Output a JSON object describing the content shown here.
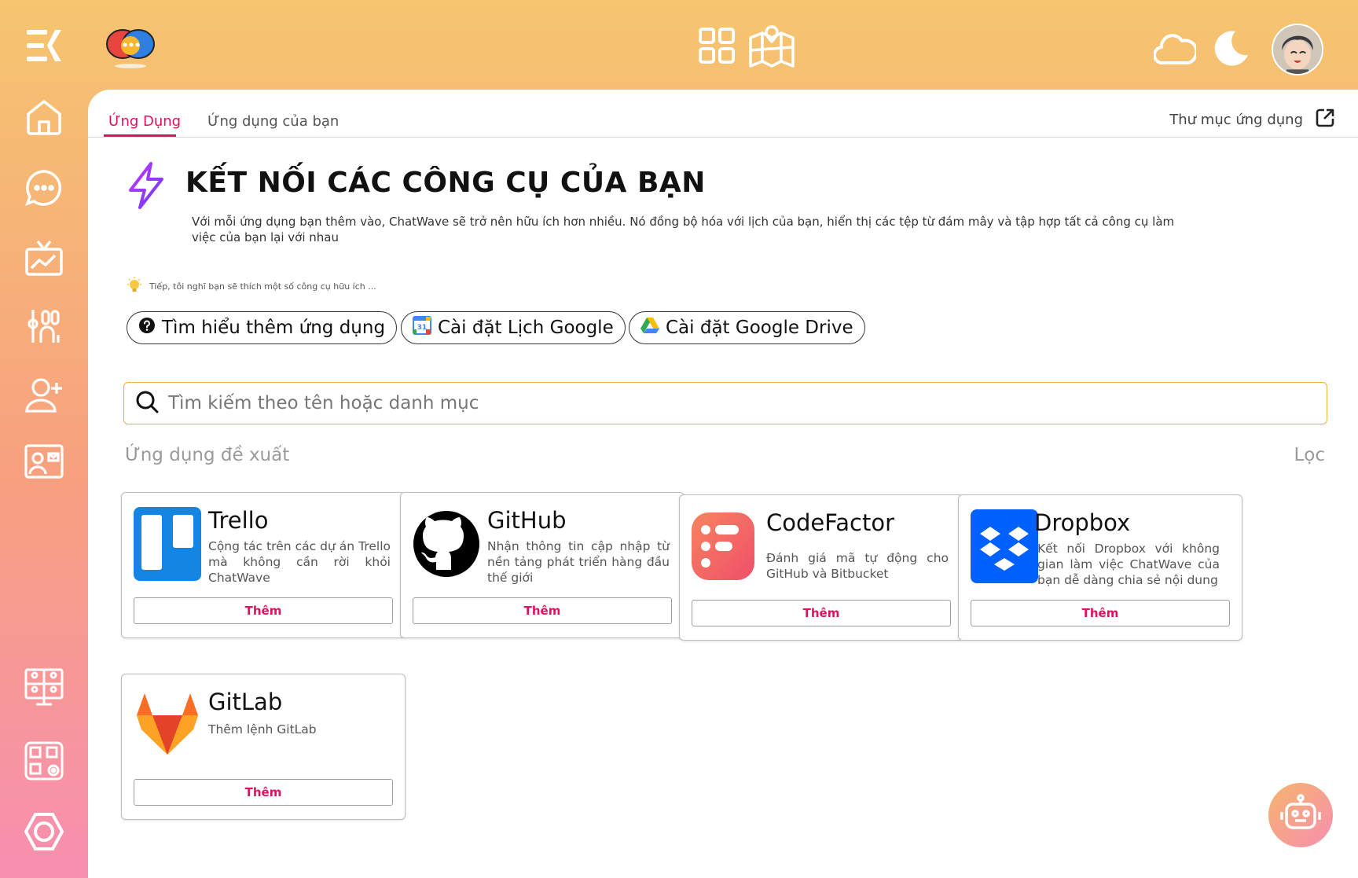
{
  "tabs": [
    {
      "label": "Ứng Dụng",
      "active": true
    },
    {
      "label": "Ứng dụng của bạn",
      "active": false
    }
  ],
  "directory_link": "Thư mục ứng dụng",
  "hero": {
    "title": "KẾT NỐI CÁC CÔNG CỤ CỦA BẠN",
    "description": "Với mỗi ứng dụng bạn thêm vào, ChatWave sẽ trở nên hữu ích hơn nhiều. Nó đồng bộ hóa với lịch của bạn, hiển thị các tệp từ đám mây và tập hợp tất cả công cụ làm việc của bạn lại với nhau"
  },
  "tip": "Tiếp, tôi nghĩ bạn sẽ thích một số công cụ hữu ích ...",
  "quick_actions": [
    {
      "label": "Tìm hiểu thêm ứng dụng",
      "icon": "help-icon"
    },
    {
      "label": "Cài đặt Lịch Google",
      "icon": "google-calendar-icon"
    },
    {
      "label": "Cài đặt Google Drive",
      "icon": "google-drive-icon"
    }
  ],
  "search": {
    "placeholder": "Tìm kiếm theo tên hoặc danh mục"
  },
  "section": {
    "label": "Ứng dụng đề xuất",
    "filter": "Lọc"
  },
  "apps": [
    {
      "name": "Trello",
      "description": "Cộng tác trên các dự án Trello mà không cần rời khỏi ChatWave",
      "button": "Thêm",
      "icon": "trello-icon",
      "color": "#0079bf"
    },
    {
      "name": "GitHub",
      "description": "Nhận thông tin cập nhập từ nền tảng phát triển hàng đầu thế giới",
      "button": "Thêm",
      "icon": "github-icon",
      "color": "#000000"
    },
    {
      "name": "CodeFactor",
      "description": "Đánh giá mã tự động cho GitHub và Bitbucket",
      "button": "Thêm",
      "icon": "codefactor-icon",
      "color": "#f16a5c"
    },
    {
      "name": "Dropbox",
      "description": "Kết nối Dropbox với không gian làm việc ChatWave của bạn dễ dàng chia sẻ nội dung",
      "button": "Thêm",
      "icon": "dropbox-icon",
      "color": "#0061fe"
    },
    {
      "name": "GitLab",
      "description": "Thêm lệnh GitLab",
      "button": "Thêm",
      "icon": "gitlab-icon",
      "color": "#fc6d26"
    }
  ],
  "colors": {
    "accent": "#e0115f",
    "search_border": "#f0b03a",
    "topbar": "#f6c56f",
    "sidebar_bottom": "#f78fb0"
  }
}
